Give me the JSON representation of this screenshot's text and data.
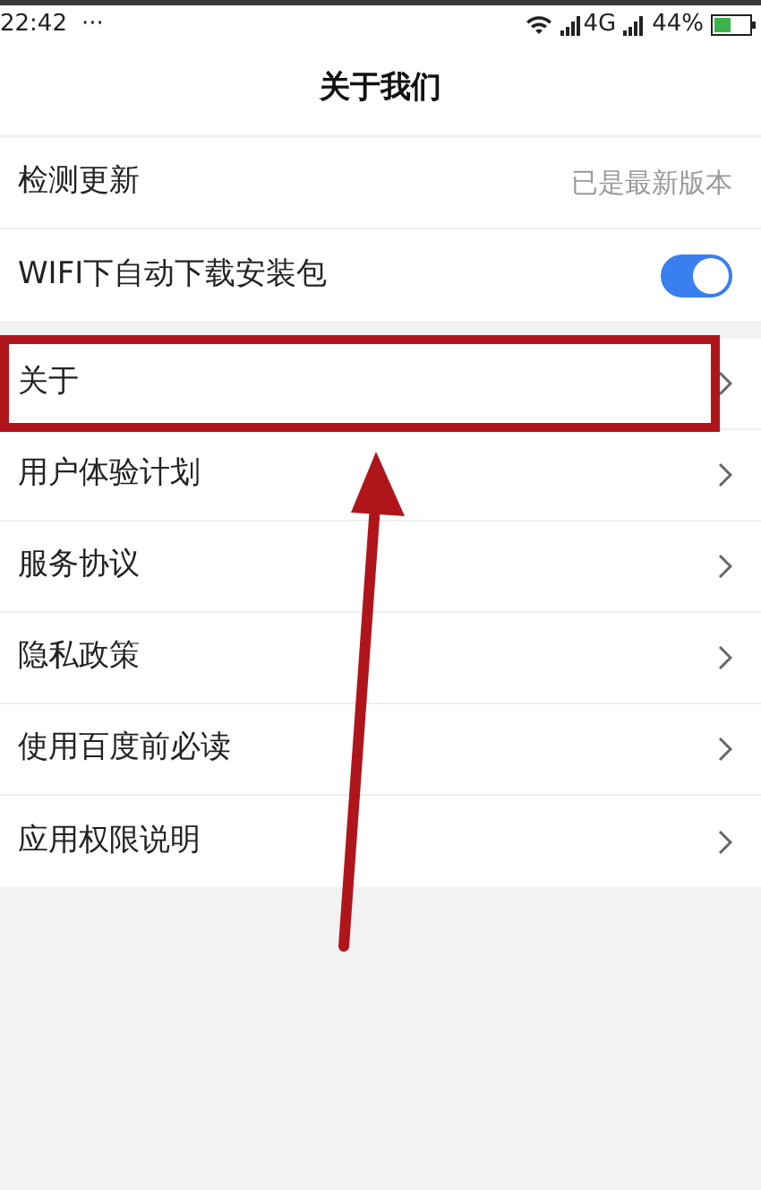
{
  "status_bar": {
    "time": "22:42",
    "more": "···",
    "network": "4G",
    "battery": "44%"
  },
  "title": "关于我们",
  "groups": [
    {
      "items": [
        {
          "kind": "value",
          "label": "检测更新",
          "value": "已是最新版本"
        },
        {
          "kind": "toggle",
          "label": "WIFI下自动下载安装包",
          "on": true
        }
      ]
    },
    {
      "items": [
        {
          "kind": "link",
          "label": "关于",
          "highlighted": true
        },
        {
          "kind": "link",
          "label": "用户体验计划",
          "highlighted": false
        },
        {
          "kind": "link",
          "label": "服务协议",
          "highlighted": false
        },
        {
          "kind": "link",
          "label": "隐私政策",
          "highlighted": false
        },
        {
          "kind": "link",
          "label": "使用百度前必读",
          "highlighted": false
        },
        {
          "kind": "link",
          "label": "应用权限说明",
          "highlighted": false
        }
      ]
    }
  ]
}
